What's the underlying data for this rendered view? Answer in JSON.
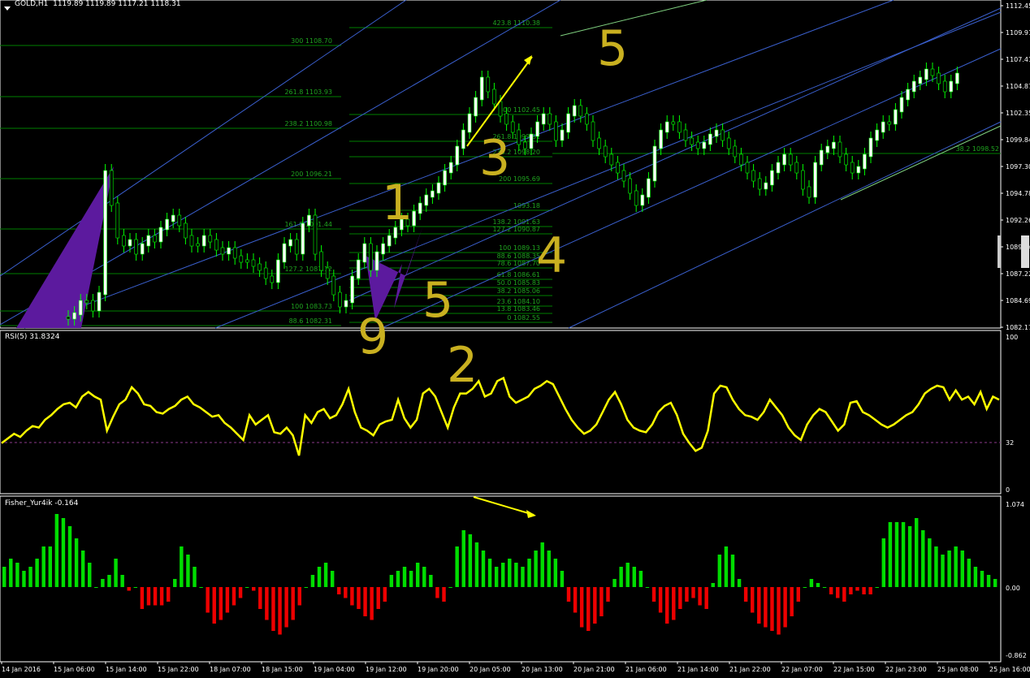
{
  "main_chart": {
    "symbol_label": "GOLD,H1",
    "ohlc": "1119.89 1119.89 1117.21 1118.31",
    "price_axis": [
      "1112.45",
      "1109.91",
      "1107.41",
      "1104.87",
      "1102.35",
      "1099.84",
      "1097.30",
      "1094.78",
      "1092.26",
      "1089.74",
      "1087.22",
      "1084.69",
      "1082.17"
    ],
    "fib_left": [
      "300 1108.70",
      "261.8 1103.93",
      "238.2 1100.98",
      "200 1096.21",
      "161.8 1091.44",
      "127.2 1087.12",
      "100 1083.73",
      "88.6 1082.31"
    ],
    "fib_mid": [
      "423.8 1110.38",
      "300 1102.45",
      "261.8 1099.81",
      "238.2 1098.20",
      "200 1095.69",
      "1093.18",
      "138.2 1091.63",
      "127.2 1090.87",
      "100 1089.13",
      "88.6 1088.35",
      "78.6 1087.70",
      "61.8 1086.61",
      "50.0 1085.83",
      "38.2 1085.06",
      "23.6 1084.10",
      "13.8 1083.46",
      "0 1082.55"
    ],
    "fib_right": "38.2 1098.52",
    "annotations": [
      "1",
      "5",
      "3",
      "4",
      "9",
      "2",
      "5"
    ]
  },
  "rsi_pane": {
    "label": "RSI(5) 31.8324",
    "scale": [
      "100",
      "32",
      "0"
    ]
  },
  "fisher_pane": {
    "label": "Fisher_Yur4ik -0.164",
    "scale": [
      "1.074",
      "0.00",
      "-0.862"
    ]
  },
  "time_axis": [
    "14 Jan 2016",
    "15 Jan 06:00",
    "15 Jan 14:00",
    "15 Jan 22:00",
    "18 Jan 07:00",
    "18 Jan 15:00",
    "19 Jan 04:00",
    "19 Jan 12:00",
    "19 Jan 20:00",
    "20 Jan 05:00",
    "20 Jan 13:00",
    "20 Jan 21:00",
    "21 Jan 06:00",
    "21 Jan 14:00",
    "21 Jan 22:00",
    "22 Jan 07:00",
    "22 Jan 15:00",
    "22 Jan 23:00",
    "25 Jan 08:00",
    "25 Jan 16:00"
  ],
  "colors": {
    "bg": "#000000",
    "grid_green": "#008000",
    "candle_up": "#000000",
    "candle_down": "#ffffff",
    "wick": "#00ff00",
    "channel_blue": "#3a5fcd",
    "purple": "#5c1a9e",
    "rsi": "#ffff00",
    "fisher_up": "#00dd00",
    "fisher_down": "#ee0000",
    "annotation": "#c9b020",
    "arrow": "#ffff00"
  },
  "chart_data": {
    "type": "candlestick",
    "rsi": [
      30,
      33,
      36,
      34,
      38,
      41,
      40,
      45,
      48,
      52,
      55,
      56,
      53,
      60,
      63,
      60,
      58,
      38,
      47,
      55,
      58,
      66,
      62,
      55,
      54,
      50,
      49,
      52,
      54,
      58,
      60,
      55,
      53,
      50,
      47,
      48,
      43,
      40,
      36,
      32,
      48,
      42,
      45,
      48,
      37,
      36,
      40,
      35,
      22,
      48,
      43,
      50,
      52,
      46,
      48,
      55,
      65,
      50,
      40,
      38,
      35,
      42,
      44,
      45,
      58,
      46,
      40,
      45,
      62,
      65,
      60,
      50,
      40,
      53,
      62,
      62,
      65,
      70,
      60,
      62,
      70,
      72,
      60,
      56,
      58,
      60,
      65,
      67,
      70,
      68,
      60,
      52,
      45,
      40,
      36,
      38,
      42,
      50,
      58,
      63,
      55,
      45,
      40,
      38,
      37,
      42,
      50,
      54,
      56,
      48,
      36,
      30,
      25,
      27,
      38,
      62,
      67,
      66,
      58,
      52,
      48,
      47,
      45,
      50,
      58,
      53,
      48,
      40,
      35,
      32,
      42,
      48,
      52,
      50,
      44,
      38,
      42,
      56,
      57,
      50,
      48,
      45,
      42,
      40,
      42,
      45,
      48,
      50,
      55,
      62,
      65,
      67,
      66,
      58,
      64,
      58,
      60,
      55,
      63,
      52,
      60,
      58
    ],
    "fisher": [
      0.25,
      0.35,
      0.3,
      0.2,
      0.25,
      0.35,
      0.5,
      0.5,
      0.9,
      0.85,
      0.75,
      0.6,
      0.45,
      0.3,
      0.0,
      0.1,
      0.15,
      0.35,
      0.15,
      -0.05,
      0.0,
      -0.3,
      -0.25,
      -0.25,
      -0.25,
      -0.2,
      0.1,
      0.5,
      0.4,
      0.25,
      0.0,
      -0.35,
      -0.5,
      -0.45,
      -0.35,
      -0.25,
      -0.15,
      0.0,
      -0.05,
      -0.3,
      -0.45,
      -0.6,
      -0.65,
      -0.55,
      -0.45,
      -0.25,
      0.0,
      0.15,
      0.25,
      0.3,
      0.2,
      -0.1,
      -0.15,
      -0.25,
      -0.3,
      -0.4,
      -0.45,
      -0.3,
      -0.2,
      0.15,
      0.2,
      0.25,
      0.2,
      0.3,
      0.25,
      0.15,
      -0.15,
      -0.2,
      0.0,
      0.5,
      0.7,
      0.65,
      0.55,
      0.45,
      0.35,
      0.25,
      0.3,
      0.35,
      0.3,
      0.25,
      0.35,
      0.45,
      0.55,
      0.45,
      0.35,
      0.2,
      -0.2,
      -0.35,
      -0.55,
      -0.6,
      -0.5,
      -0.4,
      -0.2,
      0.1,
      0.25,
      0.3,
      0.25,
      0.2,
      0.0,
      -0.2,
      -0.35,
      -0.5,
      -0.45,
      -0.3,
      -0.2,
      -0.15,
      -0.25,
      -0.3,
      0.05,
      0.4,
      0.5,
      0.4,
      0.1,
      -0.2,
      -0.35,
      -0.5,
      -0.55,
      -0.6,
      -0.65,
      -0.55,
      -0.4,
      -0.2,
      0.0,
      0.1,
      0.05,
      0.0,
      -0.1,
      -0.15,
      -0.2,
      -0.1,
      -0.05,
      -0.1,
      -0.1,
      0.0,
      0.6,
      0.8,
      0.8,
      0.8,
      0.75,
      0.85,
      0.7,
      0.6,
      0.5,
      0.4,
      0.45,
      0.5,
      0.45,
      0.35,
      0.25,
      0.2,
      0.15,
      0.1
    ]
  }
}
